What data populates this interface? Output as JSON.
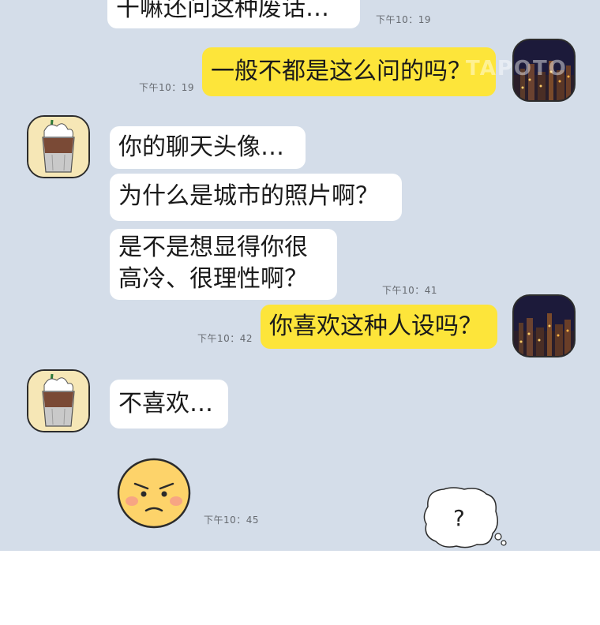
{
  "messages": [
    {
      "text": "干嘛还问这种废话…",
      "time": "下午10：19"
    },
    {
      "text": "一般不都是这么问的吗？",
      "time": "下午10：19"
    },
    {
      "text": "你的聊天头像…"
    },
    {
      "text": "为什么是城市的照片啊？"
    },
    {
      "text_line1": "是不是想显得你很",
      "text_line2": "高冷、很理性啊？",
      "time": "下午10：41"
    },
    {
      "text": "你喜欢这种人设吗？",
      "time": "下午10：42"
    },
    {
      "text": "不喜欢…"
    },
    {
      "time": "下午10：45"
    }
  ],
  "thought_bubble": {
    "text": "?"
  },
  "watermark": {
    "text": "TAPOTO"
  },
  "colors": {
    "chat_bg": "#d4dde9",
    "incoming_bubble": "#ffffff",
    "outgoing_bubble": "#fde53a"
  },
  "icons": {
    "incoming_avatar": "iced-coffee-icon",
    "outgoing_avatar": "city-night-icon",
    "reaction": "annoyed-face-icon"
  }
}
